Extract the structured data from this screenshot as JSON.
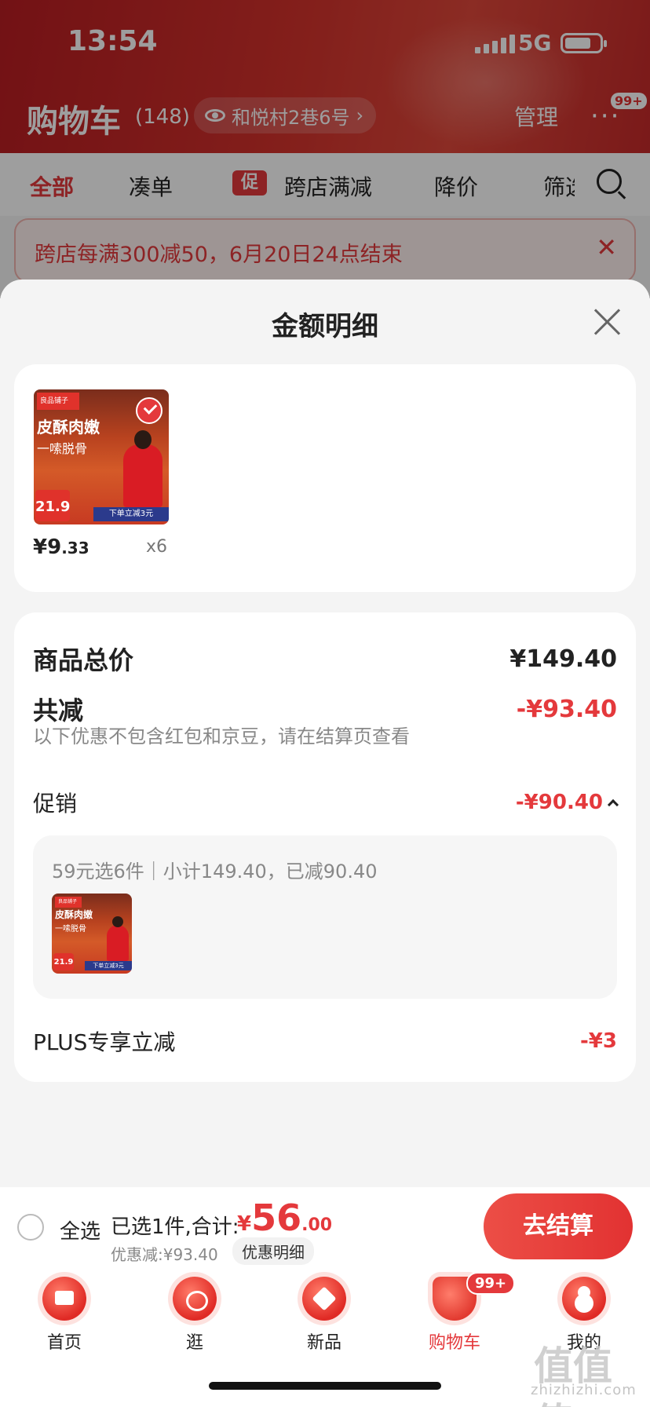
{
  "status_bar": {
    "time": "13:54",
    "network": "5G"
  },
  "cart_header": {
    "title": "购物车",
    "count": "(148)",
    "address": "和悦村2巷6号",
    "manage": "管理",
    "more_badge": "99+"
  },
  "filters": {
    "all": "全部",
    "cou": "凑单",
    "promo_tag": "促",
    "cross_store": "跨店满减",
    "price_drop": "降价",
    "filter": "筛选"
  },
  "notice": {
    "text": "跨店每满300减50，6月20日24点结束"
  },
  "sheet": {
    "title": "金额明细",
    "product": {
      "brand": "良品铺子",
      "line1": "皮酥肉嫩",
      "line2": "一嗦脱骨",
      "price_chip": "21.9",
      "bar_text": "下单立减3元",
      "price_main": "¥9",
      "price_decimal": ".33",
      "qty": "x6"
    },
    "summary": {
      "total_label": "商品总价",
      "total_value": "¥149.40",
      "reduce_label": "共减",
      "reduce_value": "-¥93.40",
      "note": "以下优惠不包含红包和京豆，请在结算页查看",
      "promo_label": "促销",
      "promo_value": "-¥90.40",
      "promo_desc": "59元选6件｜小计149.40，已减90.40",
      "plus_label": "PLUS专享立减",
      "plus_value": "-¥3"
    }
  },
  "checkout": {
    "select_all": "全选",
    "selected": "已选1件,合计:",
    "currency": "¥",
    "total_int": "56",
    "total_dec": ".00",
    "discount": "优惠减:¥93.40",
    "detail": "优惠明细",
    "button": "去结算"
  },
  "tabbar": {
    "home": "首页",
    "stroll": "逛",
    "new": "新品",
    "cart": "购物车",
    "cart_badge": "99+",
    "me": "我的"
  },
  "watermark": {
    "main": "值值值",
    "sub": "zhizhizhi.com"
  }
}
